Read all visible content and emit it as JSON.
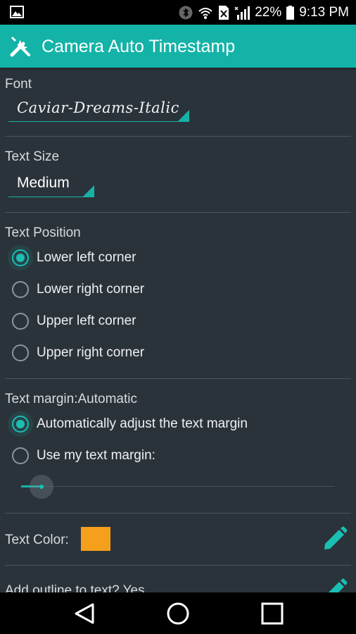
{
  "status_bar": {
    "battery_percent": "22%",
    "time": "9:13 PM",
    "icons": [
      "image-icon",
      "bluetooth-icon",
      "wifi-icon",
      "no-sim-icon",
      "signal-icon",
      "battery-icon"
    ]
  },
  "app_bar": {
    "title": "Camera Auto Timestamp",
    "icon": "wrench-screwdriver-icon",
    "color": "#14b3a8"
  },
  "settings": {
    "font": {
      "label": "Font",
      "value": "Caviar-Dreams-Italic"
    },
    "text_size": {
      "label": "Text Size",
      "value": "Medium"
    },
    "text_position": {
      "label": "Text Position",
      "options": [
        "Lower left corner",
        "Lower right corner",
        "Upper left corner",
        "Upper right corner"
      ],
      "selected": "Lower left corner"
    },
    "text_margin": {
      "label": "Text margin:Automatic",
      "options": [
        "Automatically adjust the text margin",
        "Use my text margin:"
      ],
      "selected": "Automatically adjust the text margin",
      "slider_value_fraction": 0.07
    },
    "text_color": {
      "label": "Text Color:",
      "color": "#f5a01d"
    },
    "outline": {
      "label": "Add outline to text? Yes"
    }
  },
  "nav_bar": {
    "buttons": [
      "back-icon",
      "home-icon",
      "recents-icon"
    ]
  }
}
